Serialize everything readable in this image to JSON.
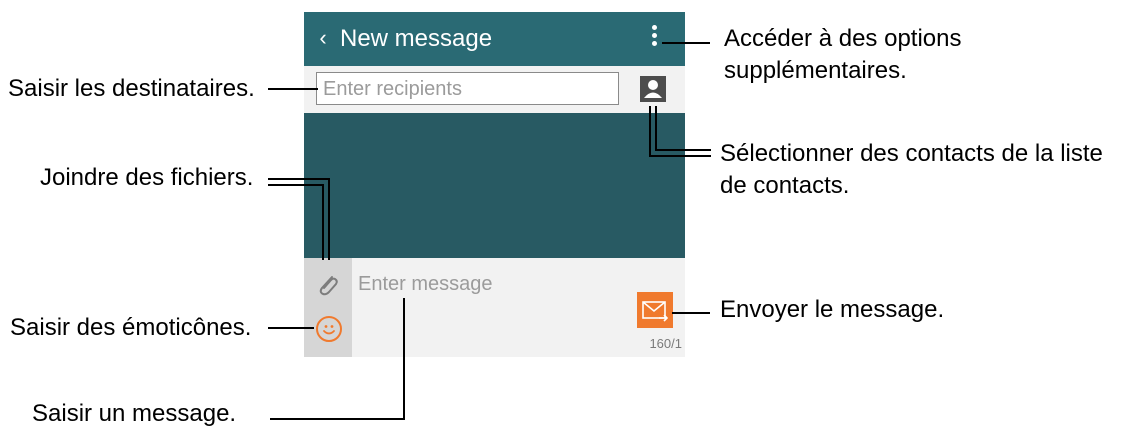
{
  "screen": {
    "title": "New message",
    "back_icon": "chevron-left-icon",
    "more_icon": "more-vertical-icon",
    "recipients_placeholder": "Enter recipients",
    "contacts_icon": "contact-icon",
    "attach_icon": "paperclip-icon",
    "emoticon_icon": "smiley-icon",
    "message_placeholder": "Enter message",
    "send_icon": "send-envelope-icon",
    "counter": "160/1"
  },
  "callouts": {
    "options": [
      "Accéder à des options",
      "supplémentaires."
    ],
    "recipients": "Saisir les destinataires.",
    "contacts": [
      "Sélectionner des contacts de la liste",
      "de contacts."
    ],
    "attach": "Joindre des fichiers.",
    "send": "Envoyer le message.",
    "emoticons": "Saisir des émoticônes.",
    "message": "Saisir un message."
  },
  "colors": {
    "topbar": "#2a6a74",
    "body": "#285a63",
    "accent": "#f07a2e"
  }
}
